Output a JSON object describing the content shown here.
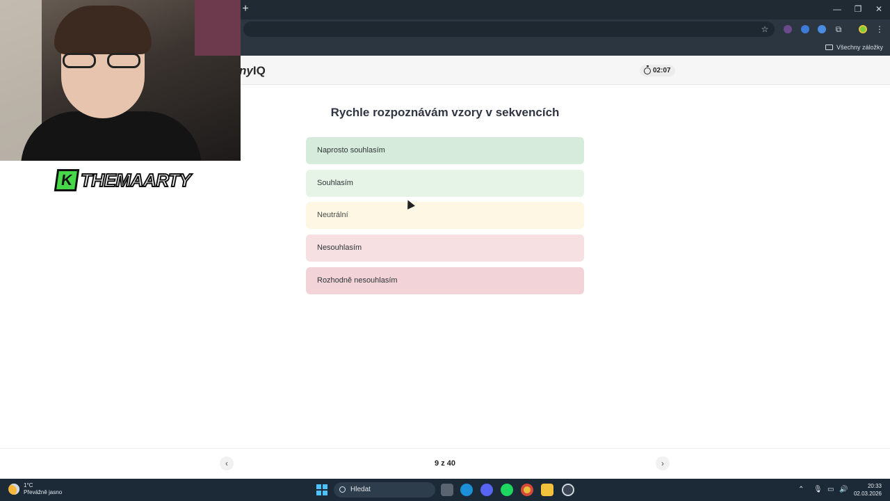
{
  "browser": {
    "new_tab_symbol": "+",
    "window_controls": [
      "—",
      "❐",
      "✕"
    ],
    "bookmarks_folder_label": "Všechny záložky"
  },
  "site": {
    "logo_partial_italic": "ny",
    "logo_bold": "IQ",
    "timer": "02:07"
  },
  "quiz": {
    "question": "Rychle rozpoznávám vzory v sekvencích",
    "options": [
      {
        "label": "Naprosto souhlasím",
        "color": "#d6ebdb"
      },
      {
        "label": "Souhlasím",
        "color": "#e6f4e8"
      },
      {
        "label": "Neutrální",
        "color": "#fdf7e3"
      },
      {
        "label": "Nesouhlasím",
        "color": "#f7e0e2"
      },
      {
        "label": "Rozhodně nesouhlasím",
        "color": "#f2d4d8"
      }
    ],
    "progress": "9 z 40",
    "prev_symbol": "‹",
    "next_symbol": "›"
  },
  "overlay": {
    "brand_text": "THEMAARTY",
    "brand_letter": "K"
  },
  "taskbar": {
    "weather_temp": "1°C",
    "weather_desc": "Převážně jasno",
    "search_placeholder": "Hledat",
    "time": "20:33",
    "date": "02.03.2026"
  }
}
